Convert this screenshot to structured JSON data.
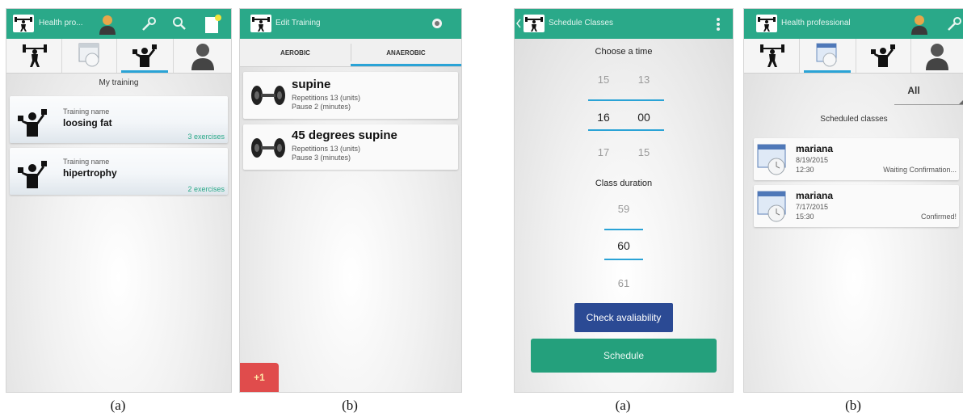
{
  "captions": [
    "(a)",
    "(b)",
    "(a)",
    "(b)"
  ],
  "screen1": {
    "title": "Health pro...",
    "heading": "My training",
    "trainings": [
      {
        "label": "Training name",
        "name": "loosing fat",
        "count": "3 exercises"
      },
      {
        "label": "Training name",
        "name": "hipertrophy",
        "count": "2 exercises"
      }
    ]
  },
  "screen2": {
    "title": "Edit Training",
    "tabs": [
      "AEROBIC",
      "ANAEROBIC"
    ],
    "exercises": [
      {
        "name": "supine",
        "repetitions": "Repetitions 13 (units)",
        "pause": "Pause 2 (minutes)"
      },
      {
        "name": "45 degrees supine",
        "repetitions": "Repetitions 13 (units)",
        "pause": "Pause 3 (minutes)"
      }
    ],
    "add_button": "+1"
  },
  "screen3": {
    "title": "Schedule Classes",
    "choose_time": "Choose a time",
    "time": {
      "prev_hour": "15",
      "prev_minute": "13",
      "hour": "16",
      "minute": "00",
      "next_hour": "17",
      "next_minute": "15"
    },
    "class_duration": "Class duration",
    "duration": {
      "prev": "59",
      "value": "60",
      "next": "61"
    },
    "check_button": "Check avaliability",
    "schedule_button": "Schedule"
  },
  "screen4": {
    "title": "Health professional",
    "filter": "All",
    "heading": "Scheduled classes",
    "classes": [
      {
        "name": "mariana",
        "date": "8/19/2015",
        "time": "12:30",
        "status": "Waiting Confirmation..."
      },
      {
        "name": "mariana",
        "date": "7/17/2015",
        "time": "15:30",
        "status": "Confirmed!"
      }
    ]
  },
  "colors": {
    "action_bar": "#2aa989",
    "tab_indicator": "#2aa3d6",
    "check_button": "#2b4a94",
    "schedule_button": "#24a07c",
    "add_button": "#e04c4c"
  }
}
